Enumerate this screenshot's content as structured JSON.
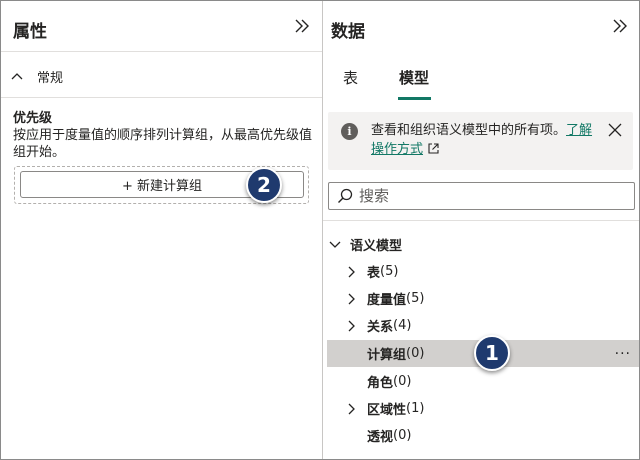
{
  "properties_pane": {
    "title": "属性",
    "section": {
      "label": "常规"
    },
    "priority": {
      "title": "优先级",
      "description": "按应用于度量值的顺序排列计算组，从最高优先级值组开始。",
      "new_button_label": "+ 新建计算组"
    }
  },
  "data_pane": {
    "title": "数据",
    "tabs": [
      {
        "label": "表",
        "active": false
      },
      {
        "label": "模型",
        "active": true
      }
    ],
    "info": {
      "text": "查看和组织语义模型中的所有项。",
      "link": "了解操作方式"
    },
    "search": {
      "placeholder": "搜索"
    },
    "tree": {
      "root": "语义模型",
      "items": [
        {
          "name": "表",
          "count": "(5)",
          "expandable": true,
          "selected": false
        },
        {
          "name": "度量值",
          "count": "(5)",
          "expandable": true,
          "selected": false
        },
        {
          "name": "关系",
          "count": "(4)",
          "expandable": true,
          "selected": false
        },
        {
          "name": "计算组",
          "count": "(0)",
          "expandable": false,
          "selected": true
        },
        {
          "name": "角色",
          "count": "(0)",
          "expandable": false,
          "selected": false
        },
        {
          "name": "区域性",
          "count": "(1)",
          "expandable": true,
          "selected": false
        },
        {
          "name": "透视",
          "count": "(0)",
          "expandable": false,
          "selected": false
        }
      ],
      "more_label": "···"
    }
  },
  "callouts": [
    "1",
    "2"
  ],
  "colors": {
    "accent": "#117865",
    "callout": "#1f3a6e",
    "selected_row": "#d2d0ce",
    "info_bg": "#f3f2f1"
  }
}
